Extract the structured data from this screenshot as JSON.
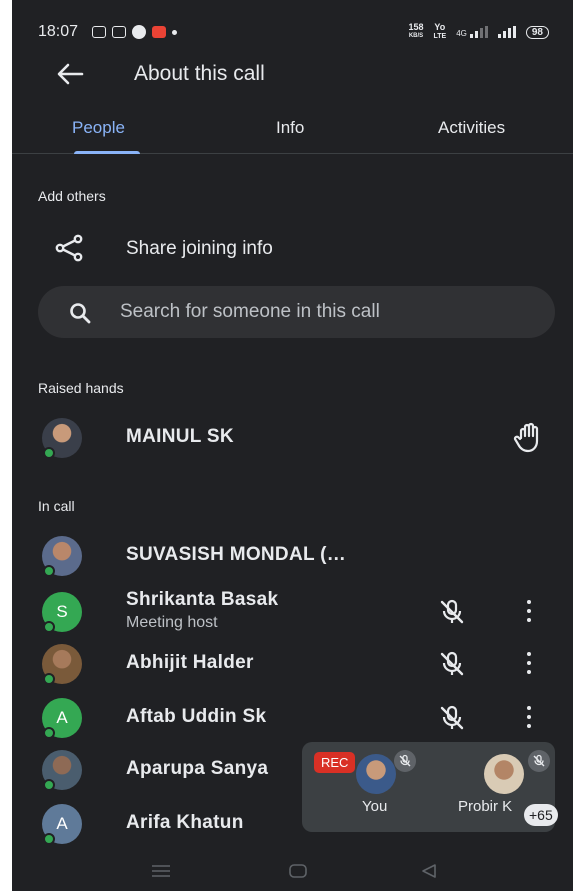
{
  "status_bar": {
    "time": "18:07",
    "speed_value": "158",
    "speed_unit": "KB/S",
    "volte_top": "Yo",
    "volte_bottom": "LTE",
    "network": "4G",
    "battery": "98"
  },
  "header": {
    "title": "About this call",
    "back_icon": "arrow-left-icon"
  },
  "tabs": [
    {
      "label": "People",
      "active": true
    },
    {
      "label": "Info",
      "active": false
    },
    {
      "label": "Activities",
      "active": false
    }
  ],
  "add_others": {
    "section_label": "Add others",
    "share_label": "Share joining info"
  },
  "search": {
    "placeholder": "Search for someone in this call"
  },
  "raised_hands": {
    "section_label": "Raised hands",
    "people": [
      {
        "name": "MAINUL SK"
      }
    ]
  },
  "in_call": {
    "section_label": "In call",
    "people": [
      {
        "name": "SUVASISH MONDAL (…",
        "subtitle": "",
        "initial": "",
        "avatar_color": ""
      },
      {
        "name": "Shrikanta Basak",
        "subtitle": "Meeting host",
        "initial": "S",
        "avatar_color": "#34a853"
      },
      {
        "name": "Abhijit Halder",
        "subtitle": "",
        "initial": "",
        "avatar_color": ""
      },
      {
        "name": "Aftab Uddin Sk",
        "subtitle": "",
        "initial": "A",
        "avatar_color": "#34a853"
      },
      {
        "name": "Aparupa Sanya",
        "subtitle": "",
        "initial": "",
        "avatar_color": ""
      },
      {
        "name": "Arifa Khatun",
        "subtitle": "",
        "initial": "A",
        "avatar_color": "#5f7a99"
      }
    ]
  },
  "video_preview": {
    "rec_label": "REC",
    "self_label": "You",
    "other_label": "Probir K",
    "more_count": "+65"
  },
  "colors": {
    "background": "#202124",
    "accent": "#8ab4f8",
    "online": "#34a853",
    "rec": "#d93025"
  }
}
